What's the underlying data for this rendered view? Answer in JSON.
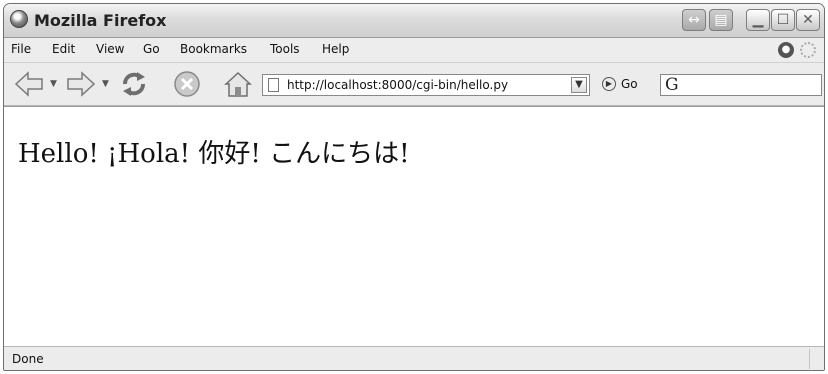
{
  "window": {
    "title": "Mozilla Firefox"
  },
  "menubar": {
    "file": "File",
    "edit": "Edit",
    "view": "View",
    "go": "Go",
    "bookmarks": "Bookmarks",
    "tools": "Tools",
    "help": "Help"
  },
  "navbar": {
    "url": "http://localhost:8000/cgi-bin/hello.py",
    "go_label": "Go",
    "search_engine_icon": "G"
  },
  "content": {
    "text": "Hello! ¡Hola! 你好! こんにちは!"
  },
  "status": {
    "text": "Done"
  },
  "icons": [
    "firefox-icon",
    "back-icon",
    "forward-icon",
    "reload-icon",
    "stop-icon",
    "home-icon",
    "page-icon",
    "go-icon",
    "throbber-icon"
  ]
}
